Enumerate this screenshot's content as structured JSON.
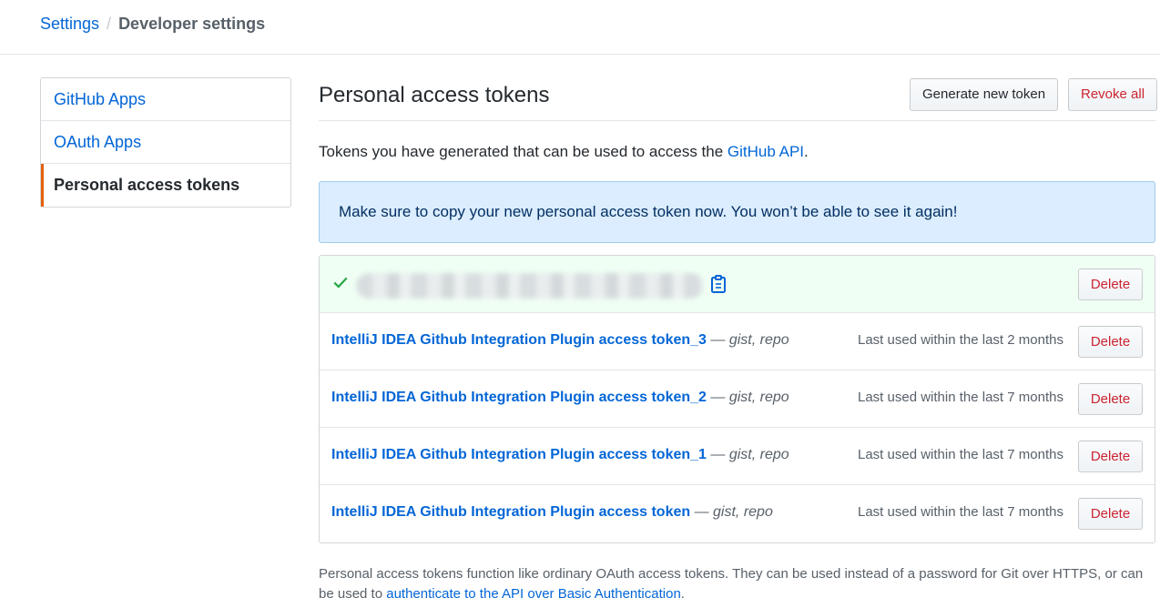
{
  "breadcrumb": {
    "root": "Settings",
    "separator": "/",
    "current": "Developer settings"
  },
  "sidebar": {
    "items": [
      {
        "label": "GitHub Apps",
        "selected": false
      },
      {
        "label": "OAuth Apps",
        "selected": false
      },
      {
        "label": "Personal access tokens",
        "selected": true
      }
    ],
    "accent_color": "#e36209"
  },
  "header": {
    "title": "Personal access tokens",
    "generate_label": "Generate new token",
    "revoke_label": "Revoke all"
  },
  "intro": {
    "text": "Tokens you have generated that can be used to access the ",
    "link": "GitHub API",
    "end": "."
  },
  "flash": {
    "text": "Make sure to copy your new personal access token now. You won’t be able to see it again!"
  },
  "new_token": {
    "delete_label": "Delete",
    "copy_icon": "clippy-icon",
    "check_icon": "check-icon"
  },
  "tokens": [
    {
      "name": "IntelliJ IDEA Github Integration Plugin access token_3",
      "dash": " — ",
      "scopes": "gist, repo",
      "last_used": "Last used within the last 2 months",
      "delete_label": "Delete"
    },
    {
      "name": "IntelliJ IDEA Github Integration Plugin access token_2",
      "dash": " — ",
      "scopes": "gist, repo",
      "last_used": "Last used within the last 7 months",
      "delete_label": "Delete"
    },
    {
      "name": "IntelliJ IDEA Github Integration Plugin access token_1",
      "dash": " — ",
      "scopes": "gist, repo",
      "last_used": "Last used within the last 7 months",
      "delete_label": "Delete"
    },
    {
      "name": "IntelliJ IDEA Github Integration Plugin access token",
      "dash": " — ",
      "scopes": "gist, repo",
      "last_used": "Last used within the last 7 months",
      "delete_label": "Delete"
    }
  ],
  "footnote": {
    "text": "Personal access tokens function like ordinary OAuth access tokens. They can be used instead of a password for Git over HTTPS, or can be used to ",
    "link": "authenticate to the API over Basic Authentication",
    "end": "."
  },
  "colors": {
    "link": "#0366d6",
    "danger": "#cb2431",
    "flash_bg": "#dbedff",
    "success_bg": "#f0fff4",
    "success_icon": "#28a745"
  }
}
